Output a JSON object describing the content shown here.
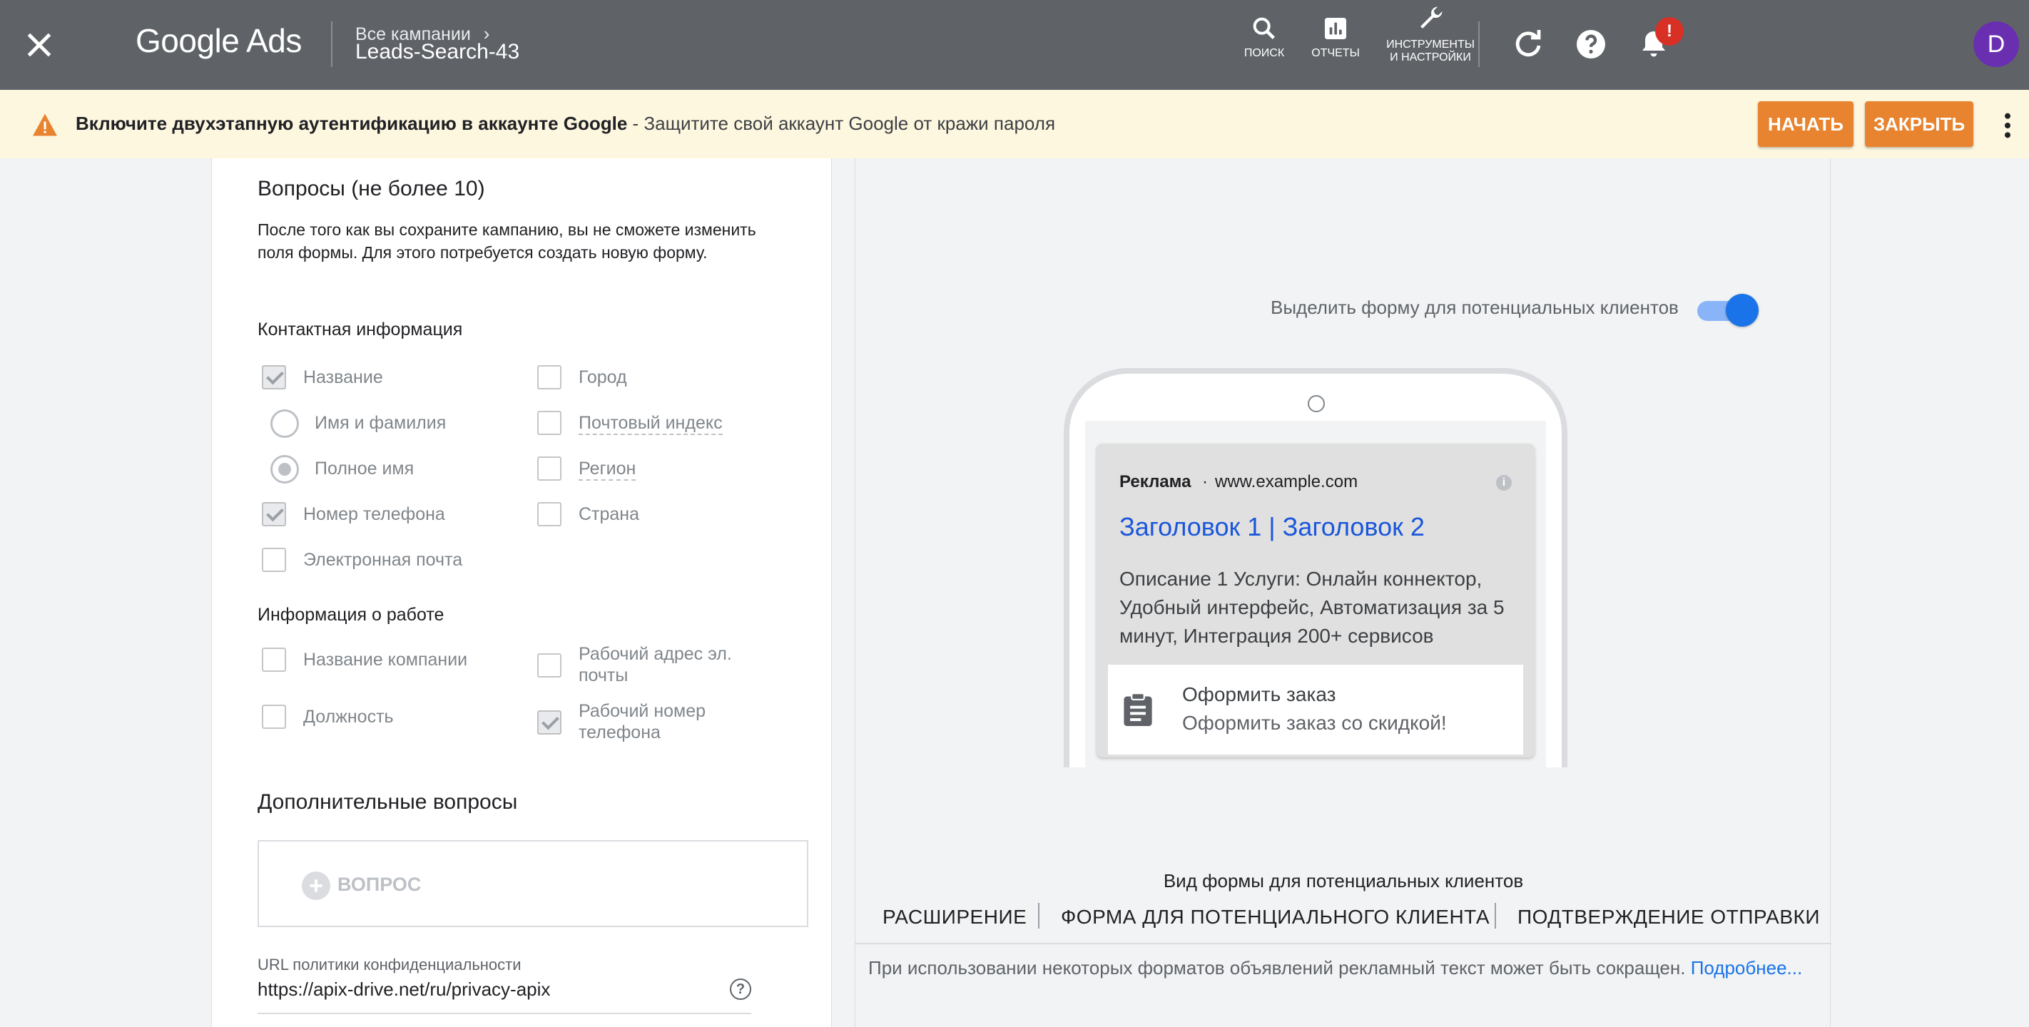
{
  "header": {
    "logo": "Google Ads",
    "breadcrumb": "Все кампании",
    "campaign": "Leads-Search-43",
    "tools": [
      {
        "label": "ПОИСК",
        "icon": "search-icon"
      },
      {
        "label": "ОТЧЕТЫ",
        "icon": "bar-chart-icon"
      },
      {
        "label": "ИНСТРУМЕНТЫ И НАСТРОЙКИ",
        "icon": "wrench-icon"
      }
    ],
    "notification_badge": "!",
    "avatar_letter": "D",
    "colors": {
      "bar": "#5f6368",
      "avatar": "#6a2fb0",
      "badge": "#d93025"
    }
  },
  "banner": {
    "bold_text": "Включите двухэтапную аутентификацию в аккаунте Google",
    "text": " - Защитите свой аккаунт Google от кражи пароля",
    "start_label": "НАЧАТЬ",
    "close_label": "ЗАКРЫТЬ",
    "colors": {
      "background": "#fef7e0",
      "button": "#e8832f"
    }
  },
  "form": {
    "title": "Вопросы (не более 10)",
    "description": "После того как вы сохраните кампанию, вы не сможете изменить поля формы. Для этого потребуется создать новую форму.",
    "contact_heading": "Контактная информация",
    "contact": {
      "name": {
        "label": "Название",
        "checked": true
      },
      "first_last": {
        "label": "Имя и фамилия",
        "selected": false
      },
      "full_name": {
        "label": "Полное имя",
        "selected": true
      },
      "phone": {
        "label": "Номер телефона",
        "checked": true
      },
      "email": {
        "label": "Электронная почта",
        "checked": false
      },
      "city": {
        "label": "Город",
        "checked": false
      },
      "zip": {
        "label": "Почтовый индекс",
        "checked": false
      },
      "region": {
        "label": "Регион",
        "checked": false
      },
      "country": {
        "label": "Страна",
        "checked": false
      }
    },
    "work_heading": "Информация о работе",
    "work": {
      "company": {
        "label": "Название компании",
        "checked": false
      },
      "job_title": {
        "label": "Должность",
        "checked": false
      },
      "work_email": {
        "label": "Рабочий адрес эл. почты",
        "checked": false
      },
      "work_phone": {
        "label": "Рабочий номер телефона",
        "checked": true
      }
    },
    "additional_heading": "Дополнительные вопросы",
    "add_question_label": "ВОПРОС",
    "privacy_label": "URL политики конфиденциальности",
    "privacy_value": "https://apix-drive.net/ru/privacy-apix"
  },
  "preview": {
    "toggle_label": "Выделить форму для потенциальных клиентов",
    "toggle_on": true,
    "ad": {
      "label": "Реклама",
      "url": "www.example.com",
      "headline": "Заголовок 1 | Заголовок 2",
      "description": "Описание 1 Услуги: Онлайн коннектор, Удобный интерфейс, Автоматизация за 5 минут, Интеграция 200+ сервисов",
      "form_title": "Оформить заказ",
      "form_subtitle": "Оформить заказ со скидкой!"
    },
    "view_caption": "Вид формы для потенциальных клиентов",
    "tabs": [
      "РАСШИРЕНИЕ",
      "ФОРМА ДЛЯ ПОТЕНЦИАЛЬНОГО КЛИЕНТА",
      "ПОДТВЕРЖДЕНИЕ ОТПРАВКИ"
    ],
    "note": "При использовании некоторых форматов объявлений рекламный текст может быть сокращен.",
    "note_link": "Подробнее..."
  }
}
